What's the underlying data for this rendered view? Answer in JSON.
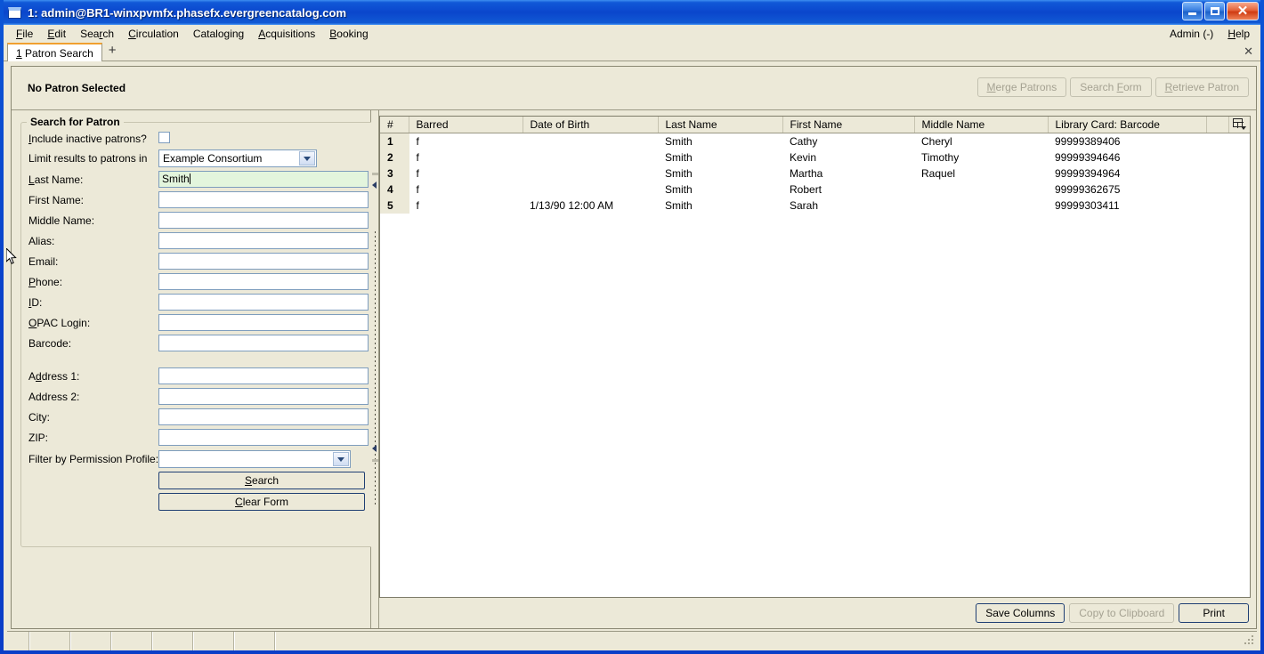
{
  "window": {
    "title": "1: admin@BR1-winxpvmfx.phasefx.evergreencatalog.com",
    "icon": "window-icon",
    "minimize_label": "",
    "maximize_label": "",
    "close_label": "✕"
  },
  "menubar": {
    "items": [
      {
        "label": "File",
        "mnemonic": "F"
      },
      {
        "label": "Edit",
        "mnemonic": "E"
      },
      {
        "label": "Search",
        "mnemonic": "r"
      },
      {
        "label": "Circulation",
        "mnemonic": "C"
      },
      {
        "label": "Cataloging",
        "mnemonic": "g"
      },
      {
        "label": "Acquisitions",
        "mnemonic": "A"
      },
      {
        "label": "Booking",
        "mnemonic": "B"
      }
    ],
    "right_items": [
      {
        "label": "Admin (-)"
      },
      {
        "label": "Help"
      }
    ]
  },
  "tabbar": {
    "tabs": [
      {
        "number": "1",
        "label": "Patron Search"
      }
    ],
    "new_tab_label": "+",
    "close_label": "✕"
  },
  "patron_bar": {
    "status": "No Patron Selected",
    "buttons": [
      {
        "label": "Merge Patrons",
        "enabled": false
      },
      {
        "label": "Search Form",
        "enabled": false
      },
      {
        "label": "Retrieve Patron",
        "enabled": false
      }
    ]
  },
  "search_form": {
    "legend": "Search for Patron",
    "include_inactive_label": "Include inactive patrons?",
    "include_inactive_checked": false,
    "limit_results_label": "Limit results to patrons in",
    "limit_results_value": "Example Consortium",
    "fields": [
      {
        "label": "Last Name:",
        "value": "Smith",
        "focused": true
      },
      {
        "label": "First Name:",
        "value": "",
        "focused": false
      },
      {
        "label": "Middle Name:",
        "value": "",
        "focused": false
      },
      {
        "label": "Alias:",
        "value": "",
        "focused": false
      },
      {
        "label": "Email:",
        "value": "",
        "focused": false
      },
      {
        "label": "Phone:",
        "value": "",
        "focused": false
      },
      {
        "label": "ID:",
        "value": "",
        "focused": false
      },
      {
        "label": "OPAC Login:",
        "value": "",
        "focused": false
      },
      {
        "label": "Barcode:",
        "value": "",
        "focused": false
      }
    ],
    "address_fields": [
      {
        "label": "Address 1:",
        "value": ""
      },
      {
        "label": "Address 2:",
        "value": ""
      },
      {
        "label": "City:",
        "value": ""
      },
      {
        "label": "ZIP:",
        "value": ""
      }
    ],
    "permission_profile_label": "Filter by Permission Profile:",
    "permission_profile_value": "",
    "search_button": "Search",
    "clear_button": "Clear Form"
  },
  "results": {
    "columns": [
      "#",
      "Barred",
      "Date of Birth",
      "Last Name",
      "First Name",
      "Middle Name",
      "Library Card: Barcode"
    ],
    "column_picker_icon": "column-picker-icon",
    "rows": [
      {
        "num": "1",
        "barred": "f",
        "dob": "",
        "last": "Smith",
        "first": "Cathy",
        "middle": "Cheryl",
        "barcode": "99999389406"
      },
      {
        "num": "2",
        "barred": "f",
        "dob": "",
        "last": "Smith",
        "first": "Kevin",
        "middle": "Timothy",
        "barcode": "99999394646"
      },
      {
        "num": "3",
        "barred": "f",
        "dob": "",
        "last": "Smith",
        "first": "Martha",
        "middle": "Raquel",
        "barcode": "99999394964"
      },
      {
        "num": "4",
        "barred": "f",
        "dob": "",
        "last": "Smith",
        "first": "Robert",
        "middle": "",
        "barcode": "99999362675"
      },
      {
        "num": "5",
        "barred": "f",
        "dob": "1/13/90 12:00 AM",
        "last": "Smith",
        "first": "Sarah",
        "middle": "",
        "barcode": "99999303411"
      }
    ],
    "footer_buttons": [
      {
        "label": "Save Columns",
        "enabled": true
      },
      {
        "label": "Copy to Clipboard",
        "enabled": false
      },
      {
        "label": "Print",
        "enabled": true
      }
    ]
  },
  "statusbar": {
    "segments": [
      "",
      "",
      "",
      "",
      "",
      "",
      "",
      ""
    ]
  },
  "colors": {
    "titlebar_blue": "#0a46cc",
    "window_face": "#ece9d8",
    "tab_accent": "#f0a030",
    "focused_field": "#e3f5dd",
    "field_border": "#7e9dbd",
    "disabled_text": "#a5a292"
  }
}
